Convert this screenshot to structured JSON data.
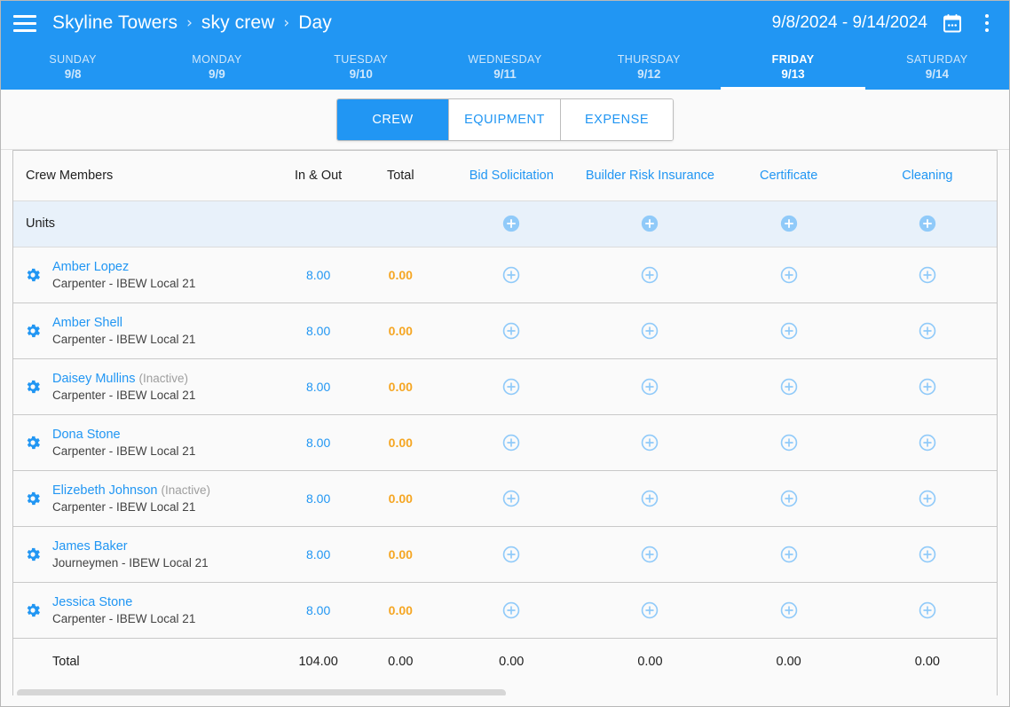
{
  "header": {
    "menu_icon": "hamburger-menu-icon",
    "breadcrumb": [
      "Skyline Towers",
      "sky crew",
      "Day"
    ],
    "separator": "›",
    "date_range": "9/8/2024 - 9/14/2024",
    "calendar_icon": "calendar-icon",
    "overflow_icon": "kebab-menu-icon",
    "accent_color": "#2196f3"
  },
  "days": [
    {
      "name": "SUNDAY",
      "date": "9/8",
      "active": false
    },
    {
      "name": "MONDAY",
      "date": "9/9",
      "active": false
    },
    {
      "name": "TUESDAY",
      "date": "9/10",
      "active": false
    },
    {
      "name": "WEDNESDAY",
      "date": "9/11",
      "active": false
    },
    {
      "name": "THURSDAY",
      "date": "9/12",
      "active": false
    },
    {
      "name": "FRIDAY",
      "date": "9/13",
      "active": true
    },
    {
      "name": "SATURDAY",
      "date": "9/14",
      "active": false
    }
  ],
  "tabs": [
    {
      "label": "CREW",
      "active": true
    },
    {
      "label": "EQUIPMENT",
      "active": false
    },
    {
      "label": "EXPENSE",
      "active": false
    }
  ],
  "table": {
    "columns": {
      "crew_members": "Crew Members",
      "in_and_out": "In & Out",
      "total": "Total",
      "cost_codes": [
        "Bid Solicitation",
        "Builder Risk Insurance",
        "Certificate",
        "Cleaning"
      ]
    },
    "units_row": {
      "label": "Units",
      "add_icon": "add-circle-filled-icon"
    },
    "row_add_icon": "add-circle-outline-icon",
    "gear_icon": "gear-icon",
    "rows": [
      {
        "name": "Amber Lopez",
        "status": "",
        "trade": "Carpenter - IBEW Local 21",
        "in_out": "8.00",
        "total": "0.00",
        "cells": [
          "",
          "",
          "",
          ""
        ]
      },
      {
        "name": "Amber Shell",
        "status": "",
        "trade": "Carpenter - IBEW Local 21",
        "in_out": "8.00",
        "total": "0.00",
        "cells": [
          "",
          "",
          "",
          ""
        ]
      },
      {
        "name": "Daisey Mullins",
        "status": "(Inactive)",
        "trade": "Carpenter - IBEW Local 21",
        "in_out": "8.00",
        "total": "0.00",
        "cells": [
          "",
          "",
          "",
          ""
        ]
      },
      {
        "name": "Dona Stone",
        "status": "",
        "trade": "Carpenter - IBEW Local 21",
        "in_out": "8.00",
        "total": "0.00",
        "cells": [
          "",
          "",
          "",
          ""
        ]
      },
      {
        "name": "Elizebeth Johnson",
        "status": "(Inactive)",
        "trade": "Carpenter - IBEW Local 21",
        "in_out": "8.00",
        "total": "0.00",
        "cells": [
          "",
          "",
          "",
          ""
        ]
      },
      {
        "name": "James Baker",
        "status": "",
        "trade": "Journeymen - IBEW Local 21",
        "in_out": "8.00",
        "total": "0.00",
        "cells": [
          "",
          "",
          "",
          ""
        ]
      },
      {
        "name": "Jessica Stone",
        "status": "",
        "trade": "Carpenter - IBEW Local 21",
        "in_out": "8.00",
        "total": "0.00",
        "cells": [
          "",
          "",
          "",
          ""
        ]
      }
    ],
    "totals": {
      "label": "Total",
      "in_out": "104.00",
      "total": "0.00",
      "cost_code_totals": [
        "0.00",
        "0.00",
        "0.00",
        "0.00"
      ]
    }
  },
  "scrollbar": {
    "name": "horizontal-scrollbar"
  }
}
